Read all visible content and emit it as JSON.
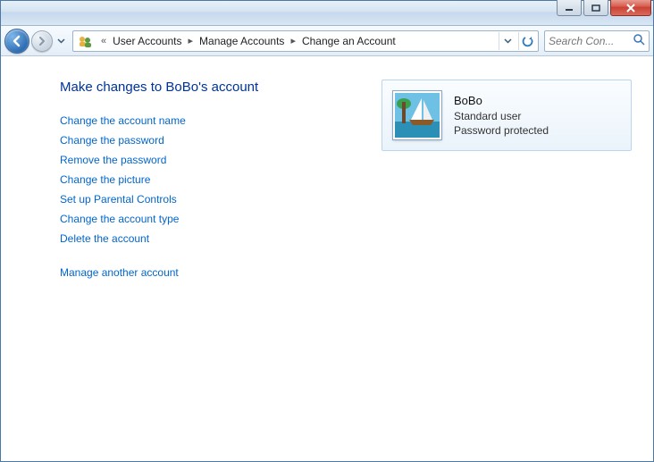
{
  "breadcrumbs": {
    "prefix": "«",
    "items": [
      "User Accounts",
      "Manage Accounts",
      "Change an Account"
    ]
  },
  "search": {
    "placeholder": "Search Con..."
  },
  "page_title": "Make changes to BoBo's account",
  "links": [
    "Change the account name",
    "Change the password",
    "Remove the password",
    "Change the picture",
    "Set up Parental Controls",
    "Change the account type",
    "Delete the account"
  ],
  "secondary_link": "Manage another account",
  "account": {
    "name": "BoBo",
    "type": "Standard user",
    "status": "Password protected"
  }
}
